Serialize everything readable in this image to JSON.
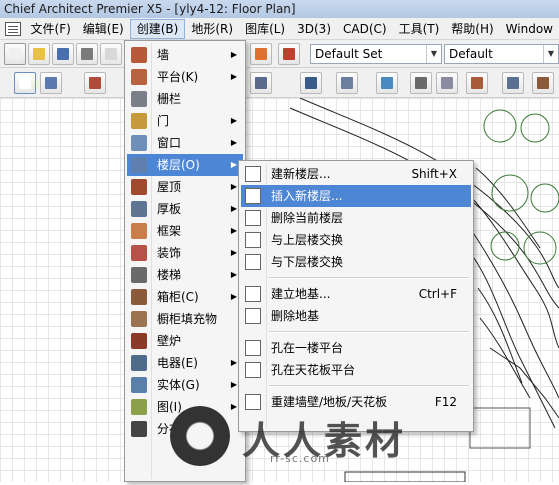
{
  "window": {
    "title": "Chief Architect Premier X5 - [yly4-12: Floor Plan]"
  },
  "menubar": {
    "items": [
      {
        "label": "文件(F)"
      },
      {
        "label": "编辑(E)"
      },
      {
        "label": "创建(B)",
        "active": true
      },
      {
        "label": "地形(R)"
      },
      {
        "label": "图库(L)"
      },
      {
        "label": "3D(3)"
      },
      {
        "label": "CAD(C)"
      },
      {
        "label": "工具(T)"
      },
      {
        "label": "帮助(H)"
      },
      {
        "label": "Window"
      }
    ]
  },
  "toolbar": {
    "layer_set": "Default Set",
    "style": "Default"
  },
  "create_menu": {
    "items": [
      {
        "label": "墙",
        "icon": "wall-icon",
        "color": "#b85a3a",
        "submenu": true
      },
      {
        "label": "平台(K)",
        "icon": "deck-icon",
        "color": "#b7633f",
        "submenu": true
      },
      {
        "label": "栅栏",
        "icon": "fence-icon",
        "color": "#7b7f8a",
        "submenu": false
      },
      {
        "label": "门",
        "icon": "door-icon",
        "color": "#c69a3b",
        "submenu": true
      },
      {
        "label": "窗口",
        "icon": "window-icon",
        "color": "#6e8fb8",
        "submenu": true
      },
      {
        "label": "楼层(O)",
        "icon": "floor-icon",
        "color": "#5f7fae",
        "submenu": true,
        "highlighted": true
      },
      {
        "label": "屋顶",
        "icon": "roof-icon",
        "color": "#a24a2e",
        "submenu": true
      },
      {
        "label": "厚板",
        "icon": "slab-icon",
        "color": "#607592",
        "submenu": true
      },
      {
        "label": "框架",
        "icon": "framing-icon",
        "color": "#c87d4a",
        "submenu": true
      },
      {
        "label": "装饰",
        "icon": "trim-icon",
        "color": "#b8514a",
        "submenu": true
      },
      {
        "label": "楼梯",
        "icon": "stairs-icon",
        "color": "#6a6a6a",
        "submenu": true
      },
      {
        "label": "箱柜(C)",
        "icon": "cabinet-icon",
        "color": "#8a5a3a",
        "submenu": true
      },
      {
        "label": "橱柜填充物",
        "icon": "cabinet-fill-icon",
        "color": "#9a7450",
        "submenu": false
      },
      {
        "label": "壁炉",
        "icon": "fireplace-icon",
        "color": "#8b3a2a",
        "submenu": false
      },
      {
        "label": "电器(E)",
        "icon": "electrical-icon",
        "color": "#4f6b8a",
        "submenu": true
      },
      {
        "label": "实体(G)",
        "icon": "solid-icon",
        "color": "#5a7fa8",
        "submenu": true
      },
      {
        "label": "图(I)",
        "icon": "image-icon",
        "color": "#8aa04a",
        "submenu": true
      },
      {
        "label": "分布对象",
        "icon": "distribute-icon",
        "color": "#444444",
        "submenu": false
      }
    ]
  },
  "floor_submenu": {
    "groups": [
      [
        {
          "label": "建新楼层...",
          "shortcut": "Shift+X",
          "icon": "new-floor-icon"
        },
        {
          "label": "插入新楼层...",
          "shortcut": "",
          "icon": "insert-floor-icon",
          "highlighted": true
        },
        {
          "label": "删除当前楼层",
          "shortcut": "",
          "icon": "delete-floor-icon"
        },
        {
          "label": "与上层楼交换",
          "shortcut": "",
          "icon": "swap-up-icon"
        },
        {
          "label": "与下层楼交换",
          "shortcut": "",
          "icon": "swap-down-icon"
        }
      ],
      [
        {
          "label": "建立地基...",
          "shortcut": "Ctrl+F",
          "icon": "foundation-icon"
        },
        {
          "label": "删除地基",
          "shortcut": "",
          "icon": "delete-foundation-icon"
        }
      ],
      [
        {
          "label": "孔在一楼平台",
          "shortcut": "",
          "icon": "hole-deck-icon"
        },
        {
          "label": "孔在天花板平台",
          "shortcut": "",
          "icon": "hole-ceiling-icon"
        }
      ],
      [
        {
          "label": "重建墙壁/地板/天花板",
          "shortcut": "F12",
          "icon": "rebuild-icon"
        }
      ]
    ]
  },
  "watermark": {
    "text": "人人素材",
    "sub": "rr-sc.com"
  }
}
